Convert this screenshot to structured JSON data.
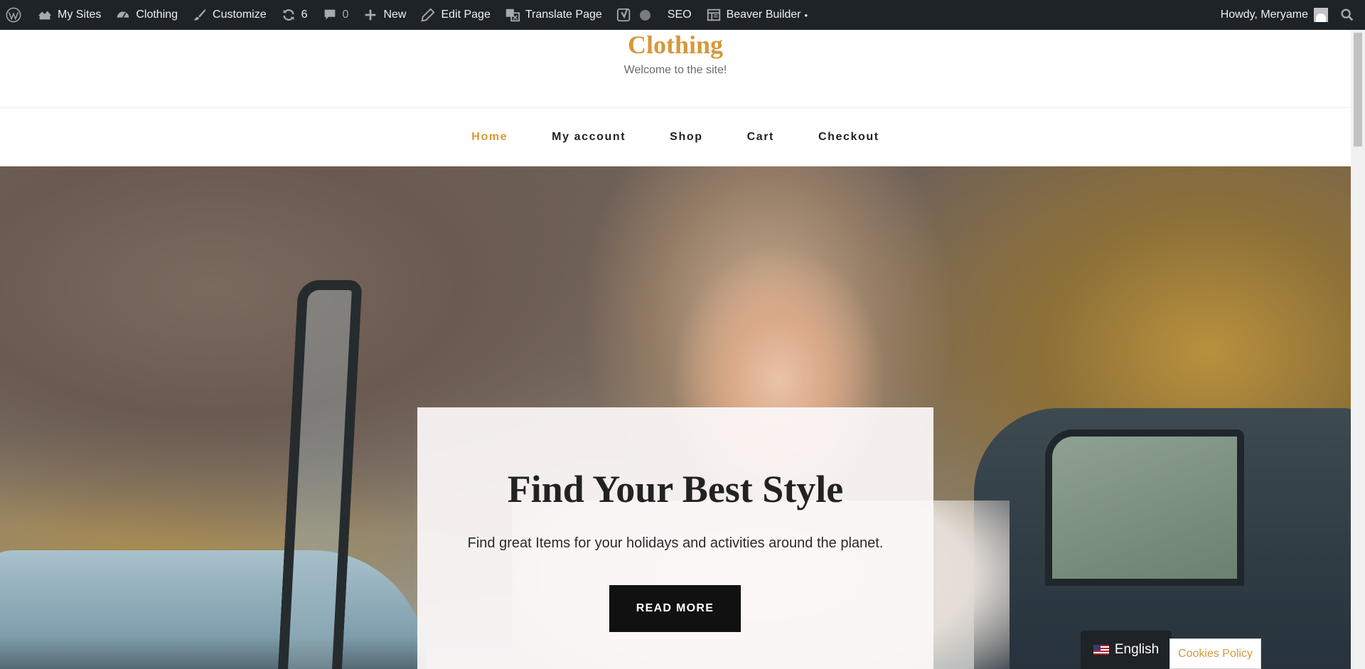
{
  "admin_bar": {
    "my_sites": "My Sites",
    "site_name": "Clothing",
    "customize": "Customize",
    "updates_count": "6",
    "comments_count": "0",
    "new": "New",
    "edit_page": "Edit Page",
    "translate_page": "Translate Page",
    "seo": "SEO",
    "beaver_builder": "Beaver Builder",
    "beaver_dot": "•",
    "howdy": "Howdy, Meryame"
  },
  "site": {
    "title": "Clothing",
    "tagline": "Welcome to the site!"
  },
  "nav": {
    "items": [
      {
        "label": "Home",
        "active": true
      },
      {
        "label": "My account",
        "active": false
      },
      {
        "label": "Shop",
        "active": false
      },
      {
        "label": "Cart",
        "active": false
      },
      {
        "label": "Checkout",
        "active": false
      }
    ]
  },
  "hero": {
    "title": "Find Your Best Style",
    "subtitle": "Find great Items for your holidays and activities around the planet.",
    "button": "READ MORE"
  },
  "language_switcher": {
    "label": "English",
    "flag": "us-flag-icon"
  },
  "cookies": {
    "label": "Cookies Policy"
  },
  "colors": {
    "accent": "#d6983b",
    "admin_bar": "#1d2327",
    "button": "#111111"
  }
}
